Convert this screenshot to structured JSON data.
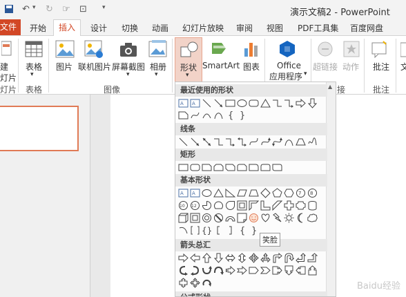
{
  "window": {
    "title": "演示文稿2 - PowerPoint"
  },
  "tabs": {
    "file": "文件",
    "items": [
      "开始",
      "插入",
      "设计",
      "切换",
      "动画",
      "幻灯片放映",
      "审阅",
      "视图",
      "PDF工具集",
      "百度网盘"
    ],
    "active": "插入"
  },
  "ribbon": {
    "new_slide_label": "建",
    "new_slide_sub": "灯片",
    "table": "表格",
    "picture": "图片",
    "online_picture": "联机图片",
    "screenshot": "屏幕截图",
    "album": "相册",
    "shapes": "形状",
    "smartart": "SmartArt",
    "chart": "图表",
    "office_line1": "Office",
    "office_line2": "应用程序",
    "hyperlink": "超链接",
    "action": "动作",
    "comment": "批注",
    "text_partial": "文",
    "groups": {
      "slides": "灯片",
      "tables": "表格",
      "images": "图像",
      "links": "接",
      "comments": "批注"
    }
  },
  "dropdown": {
    "sections": [
      "最近使用的形状",
      "线条",
      "矩形",
      "基本形状",
      "箭头总汇",
      "公式形状"
    ],
    "tooltip": "笑脸"
  },
  "colors": {
    "accent": "#d24726",
    "thumb_border": "#e07a55"
  },
  "watermark": "Baidu经验"
}
